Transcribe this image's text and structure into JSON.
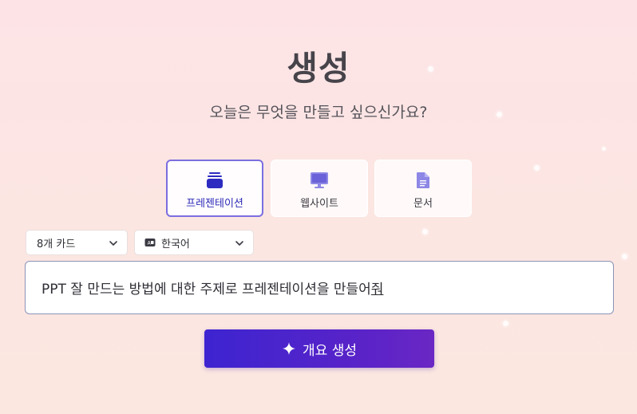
{
  "header": {
    "title": "생성",
    "subtitle": "오늘은 무엇을 만들고 싶으신가요?"
  },
  "content_types": [
    {
      "label": "프레젠테이션",
      "icon": "stack-icon",
      "selected": true
    },
    {
      "label": "웹사이트",
      "icon": "monitor-icon",
      "selected": false
    },
    {
      "label": "문서",
      "icon": "document-icon",
      "selected": false
    }
  ],
  "options": {
    "card_count": "8개 카드",
    "language": "한국어",
    "language_icon": "language-icon"
  },
  "prompt": {
    "text_main": "PPT 잘 만드는 방법에 대한 주제로 프레젠테이션을 만들어",
    "text_tail": "줘"
  },
  "generate": {
    "label": "개요 생성",
    "icon": "sparkle-icon"
  },
  "colors": {
    "accent": "#3d24d0",
    "accent_light": "#7b6ee0",
    "background": "#fde3e6"
  }
}
